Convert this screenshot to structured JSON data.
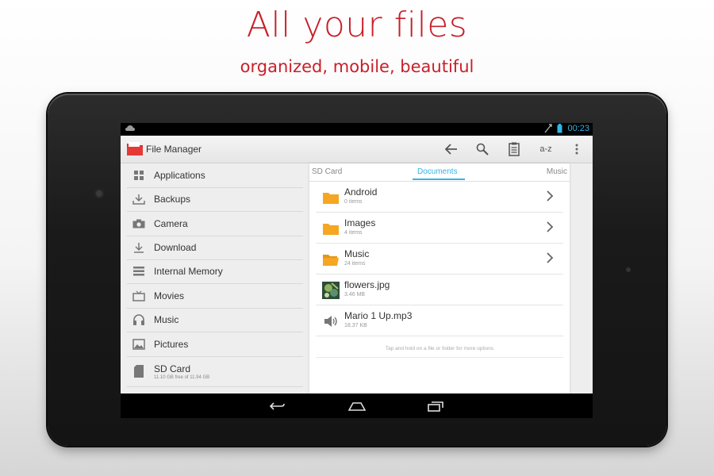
{
  "promo": {
    "headline": "All your files",
    "subline": "organized, mobile, beautiful"
  },
  "statusbar": {
    "time": "00:23"
  },
  "actionbar": {
    "app_title": "File Manager",
    "sort_label": "a-z",
    "icons": [
      "back-icon",
      "search-icon",
      "clipboard-icon",
      "sort-icon",
      "overflow-menu-icon"
    ]
  },
  "sidebar": {
    "items": [
      {
        "label": "Applications",
        "icon": "grid-icon"
      },
      {
        "label": "Backups",
        "icon": "backup-download-icon"
      },
      {
        "label": "Camera",
        "icon": "camera-icon"
      },
      {
        "label": "Download",
        "icon": "download-icon"
      },
      {
        "label": "Internal Memory",
        "icon": "memory-icon"
      },
      {
        "label": "Movies",
        "icon": "tv-icon"
      },
      {
        "label": "Music",
        "icon": "headphones-icon"
      },
      {
        "label": "Pictures",
        "icon": "picture-icon"
      },
      {
        "label": "SD Card",
        "icon": "sd-card-icon",
        "sub": "11.10 GB free of 11.94 GB"
      }
    ]
  },
  "tabs": {
    "left": "SD Card",
    "active": "Documents",
    "right": "Music"
  },
  "files": [
    {
      "name": "Android",
      "meta": "0 items",
      "type": "folder"
    },
    {
      "name": "Images",
      "meta": "4 items",
      "type": "folder"
    },
    {
      "name": "Music",
      "meta": "24 items",
      "type": "folder-open"
    },
    {
      "name": "flowers.jpg",
      "meta": "3.46 MB",
      "type": "image"
    },
    {
      "name": "Mario 1 Up.mp3",
      "meta": "18.37 KB",
      "type": "audio"
    }
  ],
  "hint": "Tap and hold on a file or folder for more options",
  "colors": {
    "brand_red": "#c8202a",
    "holo_blue": "#33b5e5",
    "folder_orange": "#f5a623"
  }
}
